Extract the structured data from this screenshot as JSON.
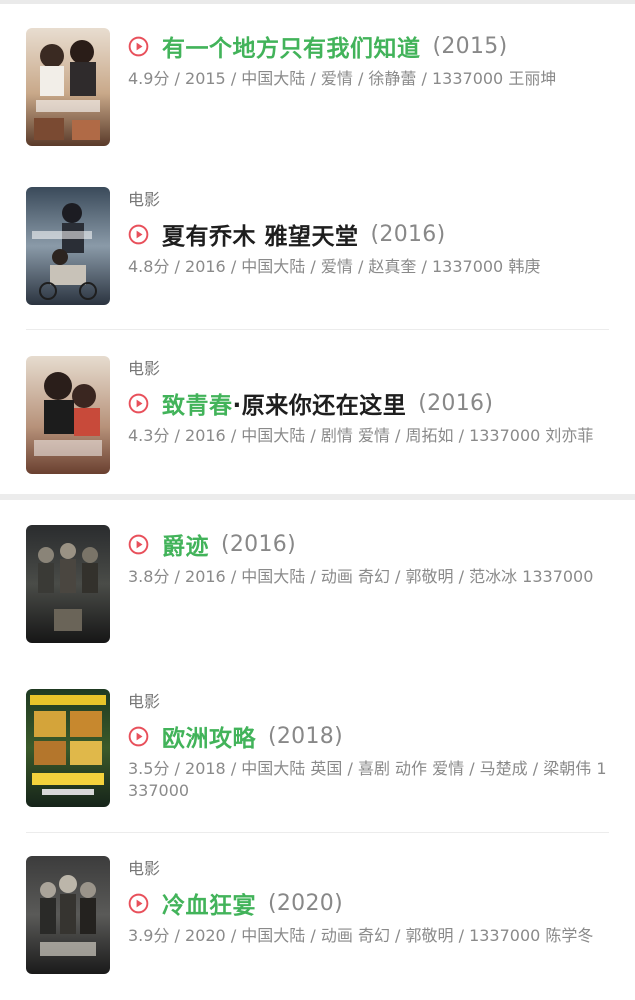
{
  "items": [
    {
      "category": "",
      "title_highlight": "有一个地方只有我们知道",
      "title_rest": "",
      "year": "(2015)",
      "meta": "4.9分 / 2015 / 中国大陆 / 爱情 / 徐静蕾 / 1337000 王丽坤",
      "poster_icon": "poster-image"
    },
    {
      "category": "电影",
      "title_highlight": "",
      "title_rest": "夏有乔木 雅望天堂",
      "year": "(2016)",
      "meta": "4.8分 / 2016 / 中国大陆 / 爱情 / 赵真奎 / 1337000 韩庚",
      "poster_icon": "poster-image"
    },
    {
      "category": "电影",
      "title_highlight": "致青春",
      "title_rest": "·原来你还在这里",
      "year": "(2016)",
      "meta": "4.3分 / 2016 / 中国大陆 / 剧情 爱情 / 周拓如 / 1337000 刘亦菲",
      "poster_icon": "poster-image"
    },
    {
      "category": "",
      "title_highlight": "爵迹",
      "title_rest": "",
      "year": "(2016)",
      "meta": "3.8分 / 2016 / 中国大陆 / 动画 奇幻 / 郭敬明 / 范冰冰 1337000",
      "poster_icon": "poster-image"
    },
    {
      "category": "电影",
      "title_highlight": "欧洲攻略",
      "title_rest": "",
      "year": "(2018)",
      "meta": "3.5分 / 2018 / 中国大陆 英国 / 喜剧 动作 爱情 / 马楚成 / 梁朝伟 1337000",
      "poster_icon": "poster-image"
    },
    {
      "category": "电影",
      "title_highlight": "冷血狂宴",
      "title_rest": "",
      "year": "(2020)",
      "meta": "3.9分 / 2020 / 中国大陆 / 动画 奇幻 / 郭敬明 / 1337000 陈学冬",
      "poster_icon": "poster-image"
    }
  ],
  "colors": {
    "accent_green": "#42b35a",
    "play_red": "#e8505b",
    "title_dark": "#1e1e1e",
    "meta_gray": "#8a8a8a"
  },
  "icons": {
    "play": "play-circle-icon"
  }
}
